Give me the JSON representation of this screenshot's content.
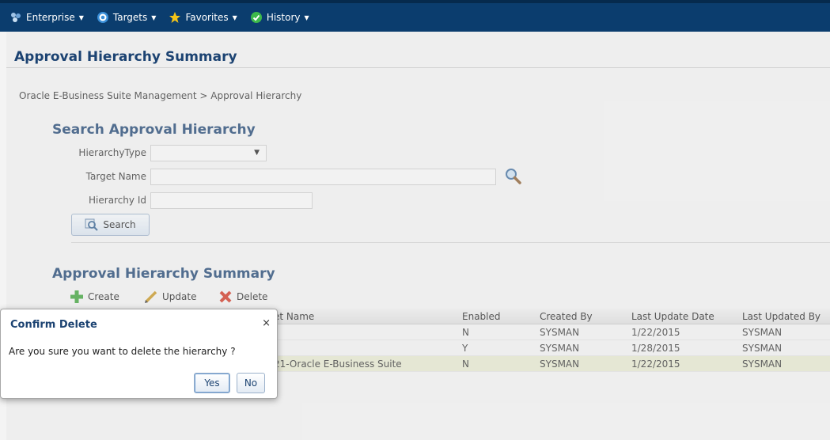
{
  "nav": {
    "items": [
      {
        "label": "Enterprise",
        "icon": "enterprise-icon"
      },
      {
        "label": "Targets",
        "icon": "targets-icon"
      },
      {
        "label": "Favorites",
        "icon": "star-icon"
      },
      {
        "label": "History",
        "icon": "history-icon"
      }
    ]
  },
  "header": {
    "title": "Approval Hierarchy Summary"
  },
  "breadcrumb": "Oracle E-Business Suite Management > Approval Hierarchy",
  "search": {
    "title": "Search Approval Hierarchy",
    "hierarchy_type_label": "HierarchyType",
    "hierarchy_type_value": "",
    "target_name_label": "Target Name",
    "target_name_value": "",
    "hierarchy_id_label": "Hierarchy Id",
    "hierarchy_id_value": "",
    "button_label": "Search"
  },
  "summary": {
    "title": "Approval Hierarchy Summary",
    "actions": {
      "create": "Create",
      "update": "Update",
      "delete": "Delete"
    }
  },
  "table": {
    "columns": [
      "et Name",
      "Enabled",
      "Created By",
      "Last Update Date",
      "Last Updated By"
    ],
    "rows": [
      [
        "",
        "N",
        "SYSMAN",
        "1/22/2015",
        "SYSMAN"
      ],
      [
        "",
        "Y",
        "SYSMAN",
        "1/28/2015",
        "SYSMAN"
      ],
      [
        "21-Oracle E-Business Suite",
        "N",
        "SYSMAN",
        "1/22/2015",
        "SYSMAN"
      ]
    ]
  },
  "dialog": {
    "title": "Confirm Delete",
    "close": "×",
    "message": "Are you sure you want to delete the hierarchy ?",
    "yes_label": "Yes",
    "no_label": "No"
  },
  "colors": {
    "nav_bg": "#0b3d6e",
    "title": "#1c4372",
    "selected_row": "#e9ecd2"
  }
}
